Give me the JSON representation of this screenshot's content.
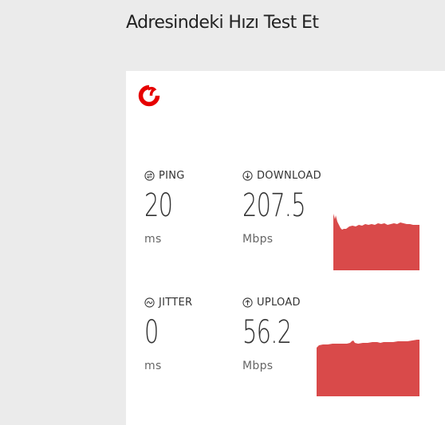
{
  "header": {
    "title": "Adresindeki Hızı Test Et"
  },
  "brand": {
    "logo_icon": "vodafone-logo-icon",
    "accent_color": "#e60000",
    "graph_color": "#d94a4a"
  },
  "metrics": {
    "ping": {
      "icon": "ping-icon",
      "label": "PING",
      "value": "20",
      "unit": "ms"
    },
    "download": {
      "icon": "download-icon",
      "label": "DOWNLOAD",
      "value": "207.5",
      "unit": "Mbps"
    },
    "jitter": {
      "icon": "jitter-icon",
      "label": "JITTER",
      "value": "0",
      "unit": "ms"
    },
    "upload": {
      "icon": "upload-icon",
      "label": "UPLOAD",
      "value": "56.2",
      "unit": "Mbps"
    }
  }
}
